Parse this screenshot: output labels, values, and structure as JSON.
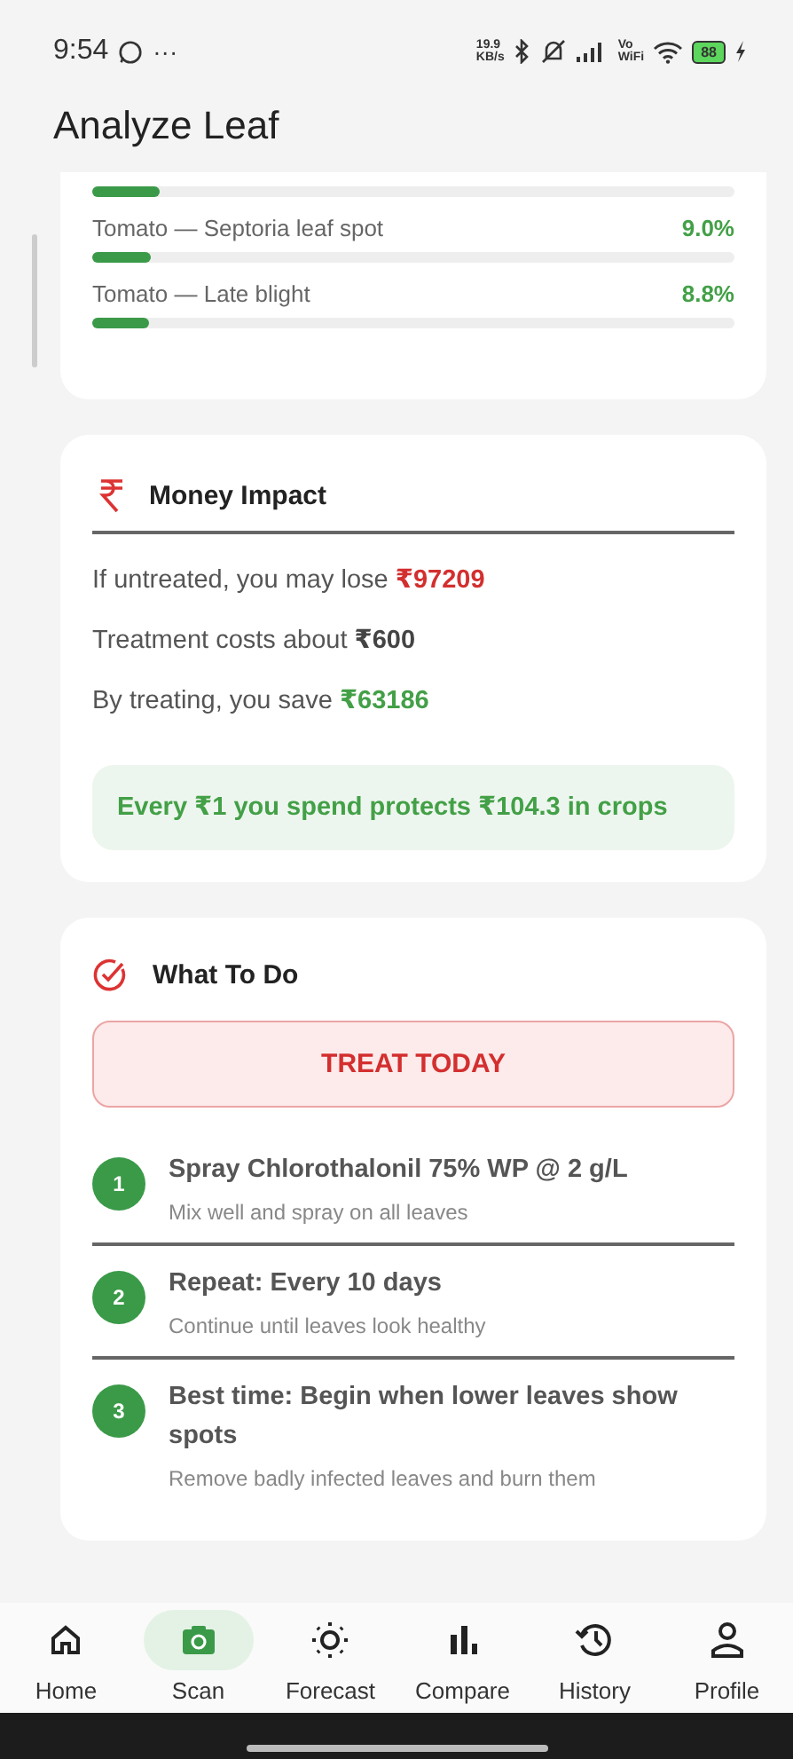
{
  "status_bar": {
    "time": "9:54",
    "dots": "···",
    "speed": "19.9",
    "speed_unit": "KB/s",
    "volte": "Vo",
    "volte_sub": "WiFi",
    "battery": "88"
  },
  "header": {
    "title": "Analyze Leaf"
  },
  "predictions": [
    {
      "level": 0.105
    },
    {
      "label": "Tomato — Septoria leaf spot",
      "reading": "9.0%",
      "level": 0.09
    },
    {
      "label": "Tomato — Late blight",
      "reading": "8.8%",
      "level": 0.088
    }
  ],
  "money": {
    "title": "Money Impact",
    "lines": [
      {
        "text": "If untreated, you may lose ",
        "amount": "₹97209",
        "color": "#d32f2f"
      },
      {
        "text": "Treatment costs about ",
        "amount": "₹600",
        "color": "#444444"
      },
      {
        "text": "By treating, you save ",
        "amount": "₹63186",
        "color": "#43a047"
      }
    ],
    "note": "Every ₹1 you spend protects ₹104.3 in crops"
  },
  "actions": {
    "title": "What To Do",
    "urgency": "TREAT TODAY",
    "steps": [
      {
        "number": "1",
        "title": "Spray Chlorothalonil 75% WP @ 2 g/L",
        "detail": "Mix well and spray on all leaves"
      },
      {
        "number": "2",
        "title": "Repeat: Every 10 days",
        "detail": "Continue until leaves look healthy"
      },
      {
        "number": "3",
        "title": "Best time: Begin when lower leaves show spots",
        "detail": "Remove badly infected leaves and burn them"
      }
    ]
  },
  "nav": [
    {
      "label": "Home",
      "kind": "home",
      "selected": false
    },
    {
      "label": "Scan",
      "kind": "camera",
      "selected": true
    },
    {
      "label": "Forecast",
      "kind": "sun",
      "selected": false
    },
    {
      "label": "Compare",
      "kind": "bars",
      "selected": false
    },
    {
      "label": "History",
      "kind": "history",
      "selected": false
    },
    {
      "label": "Profile",
      "kind": "person",
      "selected": false
    }
  ]
}
